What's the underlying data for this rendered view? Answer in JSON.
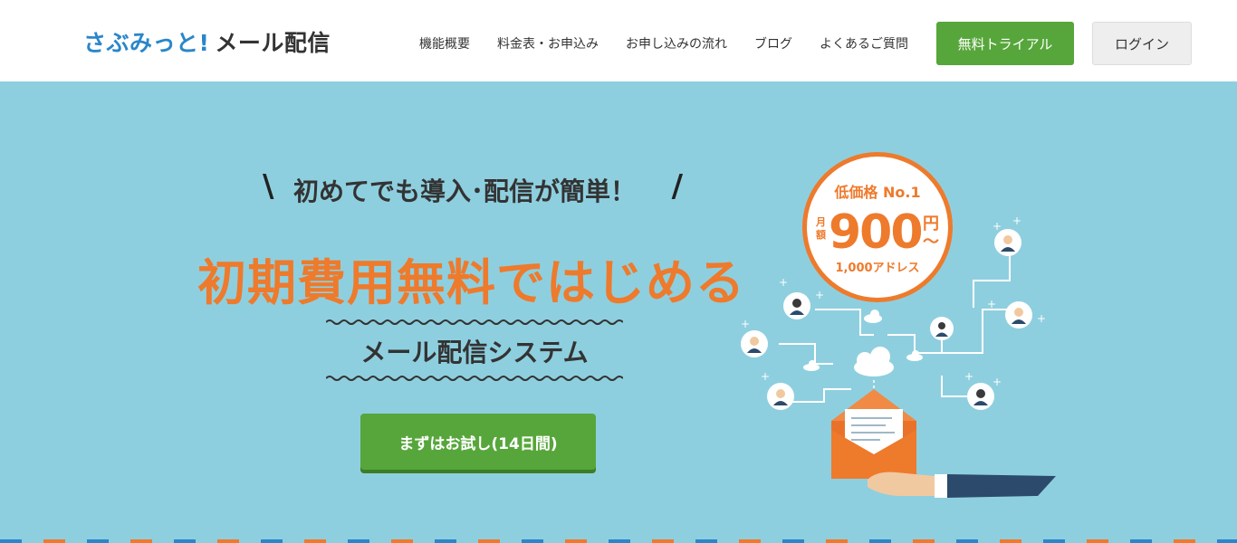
{
  "header": {
    "logo_brand": "さぶみっと!",
    "logo_product": "メール配信",
    "nav": [
      {
        "label": "機能概要"
      },
      {
        "label": "料金表・お申込み"
      },
      {
        "label": "お申し込みの流れ"
      },
      {
        "label": "ブログ"
      },
      {
        "label": "よくあるご質問"
      }
    ],
    "trial_button": "無料トライアル",
    "login_button": "ログイン"
  },
  "hero": {
    "tagline": "初めてでも導入･配信が簡単！",
    "headline": "初期費用無料ではじめる",
    "subtitle": "メール配信システム",
    "cta_button": "まずはお試し(14日間)",
    "badge": {
      "top": "低価格 No.1",
      "monthly": "月額",
      "price": "900",
      "yen": "円",
      "tilde": "〜",
      "addresses": "1,000アドレス"
    }
  },
  "colors": {
    "brand_blue": "#2a86c9",
    "accent_orange": "#ee7a2c",
    "cta_green": "#57a63b",
    "hero_bg": "#8ecfdf"
  }
}
